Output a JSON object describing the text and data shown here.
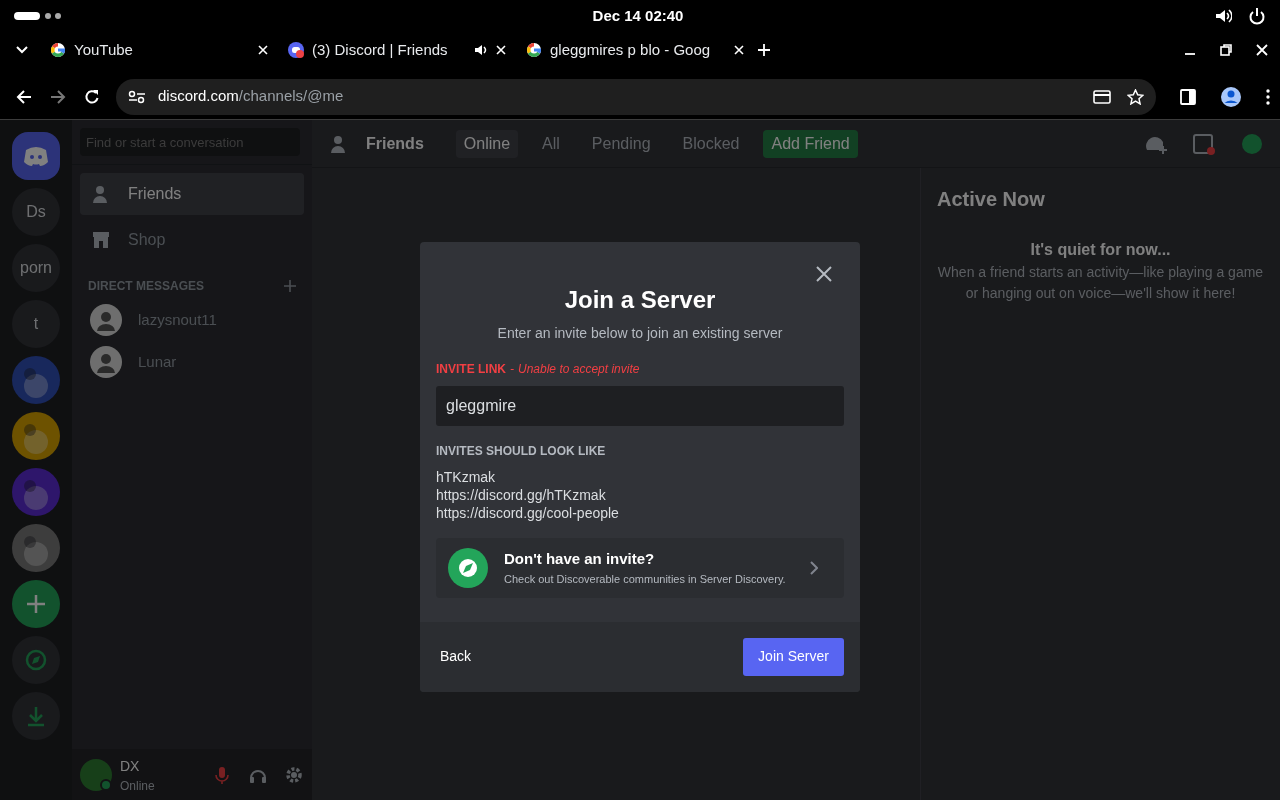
{
  "system_bar": {
    "clock": "Dec 14  02:40"
  },
  "browser": {
    "tabs": [
      {
        "title": "YouTube",
        "kind": "google",
        "audio": false
      },
      {
        "title": "(3) Discord | Friends",
        "kind": "discord",
        "audio": true
      },
      {
        "title": "gleggmires p blo - Goog",
        "kind": "google",
        "audio": false
      }
    ],
    "address": {
      "host": "discord.com",
      "path": "/channels/@me"
    }
  },
  "servers": [
    {
      "kind": "home"
    },
    {
      "kind": "text",
      "label": "Ds"
    },
    {
      "kind": "text",
      "label": "porn"
    },
    {
      "kind": "text",
      "label": "t"
    },
    {
      "kind": "picture"
    },
    {
      "kind": "picture"
    },
    {
      "kind": "picture"
    },
    {
      "kind": "picture"
    },
    {
      "kind": "add"
    },
    {
      "kind": "discover"
    },
    {
      "kind": "download"
    }
  ],
  "dm_sidebar": {
    "search": {
      "placeholder": "Find or start a conversation"
    },
    "nav": [
      {
        "label": "Friends",
        "kind": "friends",
        "selected": true
      },
      {
        "label": "Shop",
        "kind": "shop",
        "selected": false
      }
    ],
    "section": "DIRECT MESSAGES",
    "dms": [
      {
        "name": "lazysnout11"
      },
      {
        "name": "Lunar"
      }
    ],
    "user": {
      "name": "DX",
      "status": "Online"
    }
  },
  "friends_header": {
    "title": "Friends",
    "tabs": [
      {
        "label": "Online",
        "kind": "tab",
        "selected": true
      },
      {
        "label": "All",
        "kind": "tab",
        "selected": false
      },
      {
        "label": "Pending",
        "kind": "tab",
        "selected": false
      },
      {
        "label": "Blocked",
        "kind": "tab",
        "selected": false
      },
      {
        "label": "Add Friend",
        "kind": "add",
        "selected": false
      }
    ]
  },
  "active_now": {
    "title": "Active Now",
    "subtitle": "It's quiet for now...",
    "text": "When a friend starts an activity—like playing a game or hanging out on voice—we'll show it here!"
  },
  "modal": {
    "title": "Join a Server",
    "subtitle": "Enter an invite below to join an existing server",
    "field_label": "INVITE LINK",
    "separator": "-",
    "error": "Unable to accept invite",
    "value": "gleggmire",
    "examples_title": "INVITES SHOULD LOOK LIKE",
    "examples": [
      "hTKzmak",
      "https://discord.gg/hTKzmak",
      "https://discord.gg/cool-people"
    ],
    "discovery": {
      "title": "Don't have an invite?",
      "text": "Check out Discoverable communities in Server Discovery."
    },
    "back": "Back",
    "submit": "Join Server"
  }
}
